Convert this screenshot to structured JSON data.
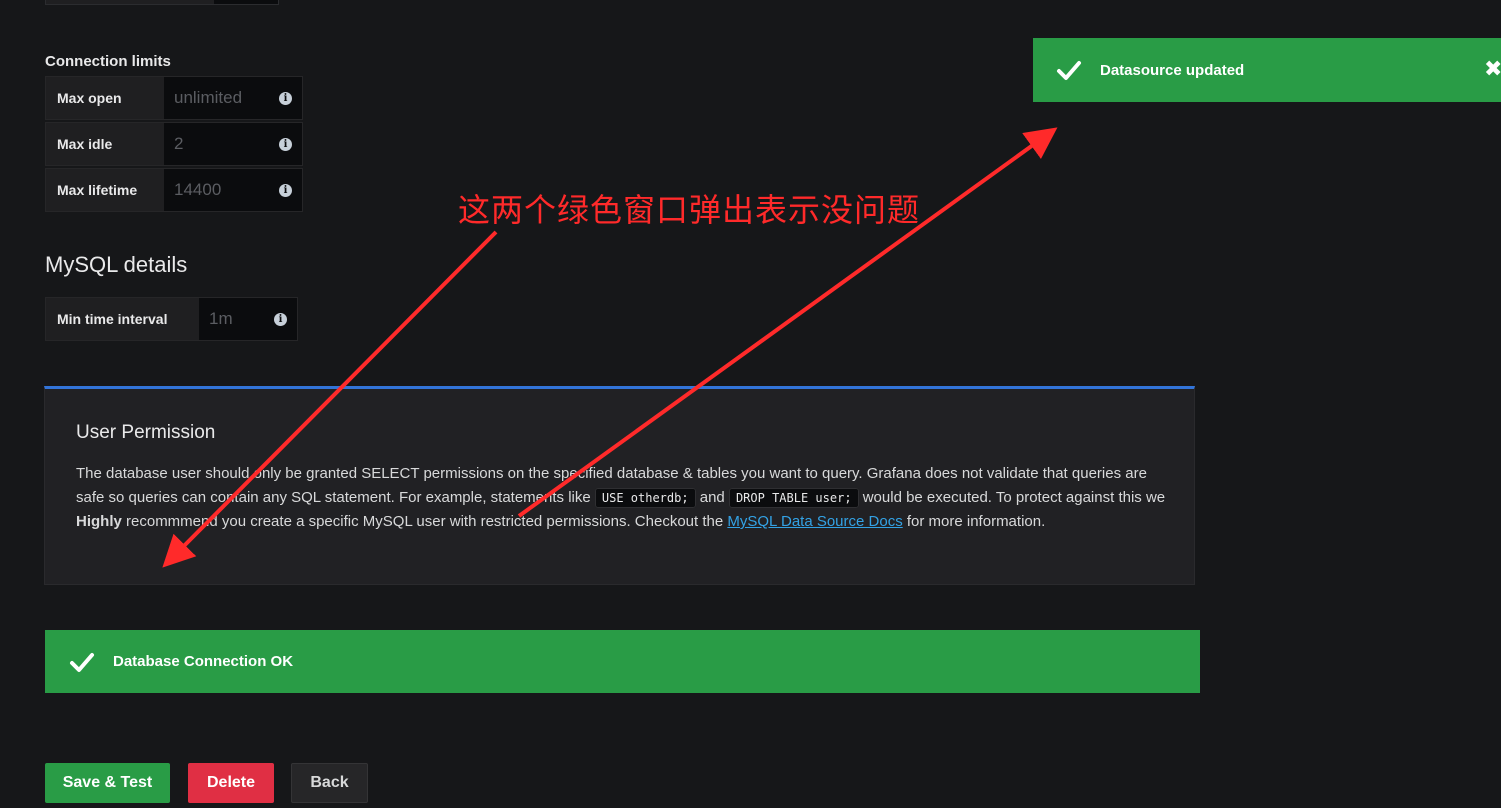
{
  "connection_limits": {
    "title": "Connection limits",
    "rows": [
      {
        "label": "Max open",
        "placeholder": "unlimited"
      },
      {
        "label": "Max idle",
        "placeholder": "2"
      },
      {
        "label": "Max lifetime",
        "placeholder": "14400"
      }
    ]
  },
  "mysql_details": {
    "title": "MySQL details",
    "min_time_label": "Min time interval",
    "min_time_placeholder": "1m"
  },
  "user_permission": {
    "title": "User Permission",
    "text_1": "The database user should only be granted SELECT permissions on the specified database & tables you want to query. Grafana does not validate that queries are safe so queries can contain any SQL statement. For example, statements like ",
    "code_1": "USE otherdb;",
    "text_2": " and ",
    "code_2": "DROP TABLE user;",
    "text_3": " would be executed. To protect against this we ",
    "highly": "Highly",
    "text_4": " recommmend you create a specific MySQL user with restricted permissions. Checkout the ",
    "link": "MySQL Data Source Docs",
    "text_5": " for more information."
  },
  "alerts": {
    "db_connection": "Database Connection OK",
    "toast": "Datasource updated",
    "toast_close": "✖"
  },
  "buttons": {
    "save": "Save & Test",
    "delete": "Delete",
    "back": "Back"
  },
  "annotation": {
    "text": "这两个绿色窗口弹出表示没问题",
    "color": "#ff2a2a"
  },
  "colors": {
    "success": "#299c46",
    "danger": "#e02f44",
    "accent": "#3274d9",
    "link": "#33a2e5"
  },
  "icons": [
    "info-icon",
    "check-icon",
    "close-icon",
    "arrow-annotation"
  ]
}
